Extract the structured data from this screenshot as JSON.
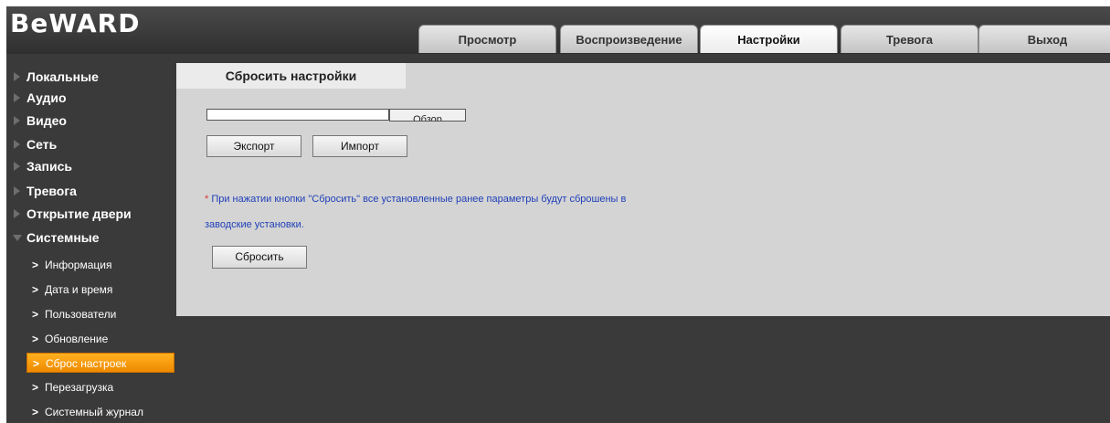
{
  "logo": "BeWARD",
  "tabs": [
    {
      "label": "Просмотр",
      "active": false
    },
    {
      "label": "Воспроизведение",
      "active": false
    },
    {
      "label": "Настройки",
      "active": true
    },
    {
      "label": "Тревога",
      "active": false
    },
    {
      "label": "Выход",
      "active": false
    }
  ],
  "sidebar": {
    "categories": [
      {
        "label": "Локальные",
        "expanded": false
      },
      {
        "label": "Аудио",
        "expanded": false
      },
      {
        "label": "Видео",
        "expanded": false
      },
      {
        "label": "Сеть",
        "expanded": false
      },
      {
        "label": "Запись",
        "expanded": false
      },
      {
        "label": "Тревога",
        "expanded": false
      },
      {
        "label": "Открытие двери",
        "expanded": false
      },
      {
        "label": "Системные",
        "expanded": true
      }
    ],
    "subitems": [
      {
        "label": "Информация",
        "active": false
      },
      {
        "label": "Дата и время",
        "active": false
      },
      {
        "label": "Пользователи",
        "active": false
      },
      {
        "label": "Обновление",
        "active": false
      },
      {
        "label": "Сброс настроек",
        "active": true
      },
      {
        "label": "Перезагрузка",
        "active": false
      },
      {
        "label": "Системный журнал",
        "active": false
      }
    ]
  },
  "panel": {
    "tab_label": "Сбросить настройки",
    "file_path_value": "",
    "browse_label": "Обзор",
    "export_label": "Экспорт",
    "import_label": "Импорт",
    "note_star": "*",
    "note_line1": " При нажатии кнопки \"Сбросить\" все установленные ранее параметры будут сброшены в",
    "note_line2": "заводские установки.",
    "reset_label": "Сбросить"
  },
  "colors": {
    "accent": "#f59a10",
    "note_text": "#1f3fb8",
    "note_star": "#e03030",
    "background": "#3a3a3a",
    "panel": "#d4d4d4"
  }
}
